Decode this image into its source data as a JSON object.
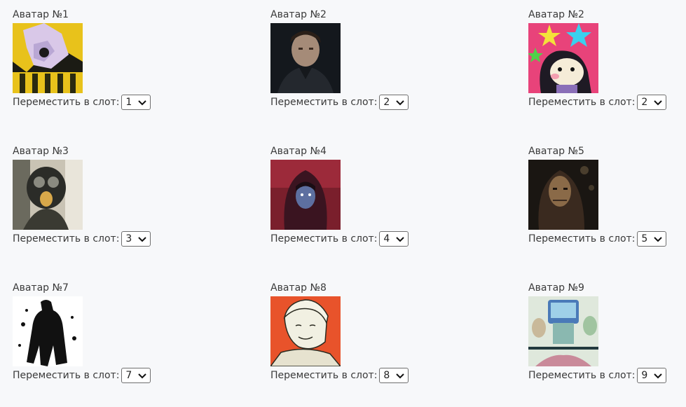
{
  "move_label": "Переместить в слот:",
  "avatars": [
    {
      "title": "Аватар №1",
      "slot": "1",
      "image": "yellow-haired-anime-character-avatar",
      "accent": "#e8c21b"
    },
    {
      "title": "Аватар №2",
      "slot": "2",
      "image": "dark-haired-man-in-leather-jacket-avatar",
      "accent": "#2a2f36"
    },
    {
      "title": "Аватар №2",
      "slot": "2",
      "image": "cartoon-character-with-stars-avatar",
      "accent": "#e8437a"
    },
    {
      "title": "Аватар №3",
      "slot": "3",
      "image": "gas-mask-figure-avatar",
      "accent": "#3e4a40"
    },
    {
      "title": "Аватар №4",
      "slot": "4",
      "image": "hooded-figure-red-background-avatar",
      "accent": "#7a1f2c"
    },
    {
      "title": "Аватар №5",
      "slot": "5",
      "image": "masked-hooded-figure-dark-avatar",
      "accent": "#3a2a1f"
    },
    {
      "title": "Аватар №7",
      "slot": "7",
      "image": "black-and-white-silhouette-avatar",
      "accent": "#111111"
    },
    {
      "title": "Аватар №8",
      "slot": "8",
      "image": "sketched-smiling-man-orange-background-avatar",
      "accent": "#e8532b"
    },
    {
      "title": "Аватар №9",
      "slot": "9",
      "image": "anime-character-with-monitor-head-avatar",
      "accent": "#9fcfd6"
    }
  ]
}
